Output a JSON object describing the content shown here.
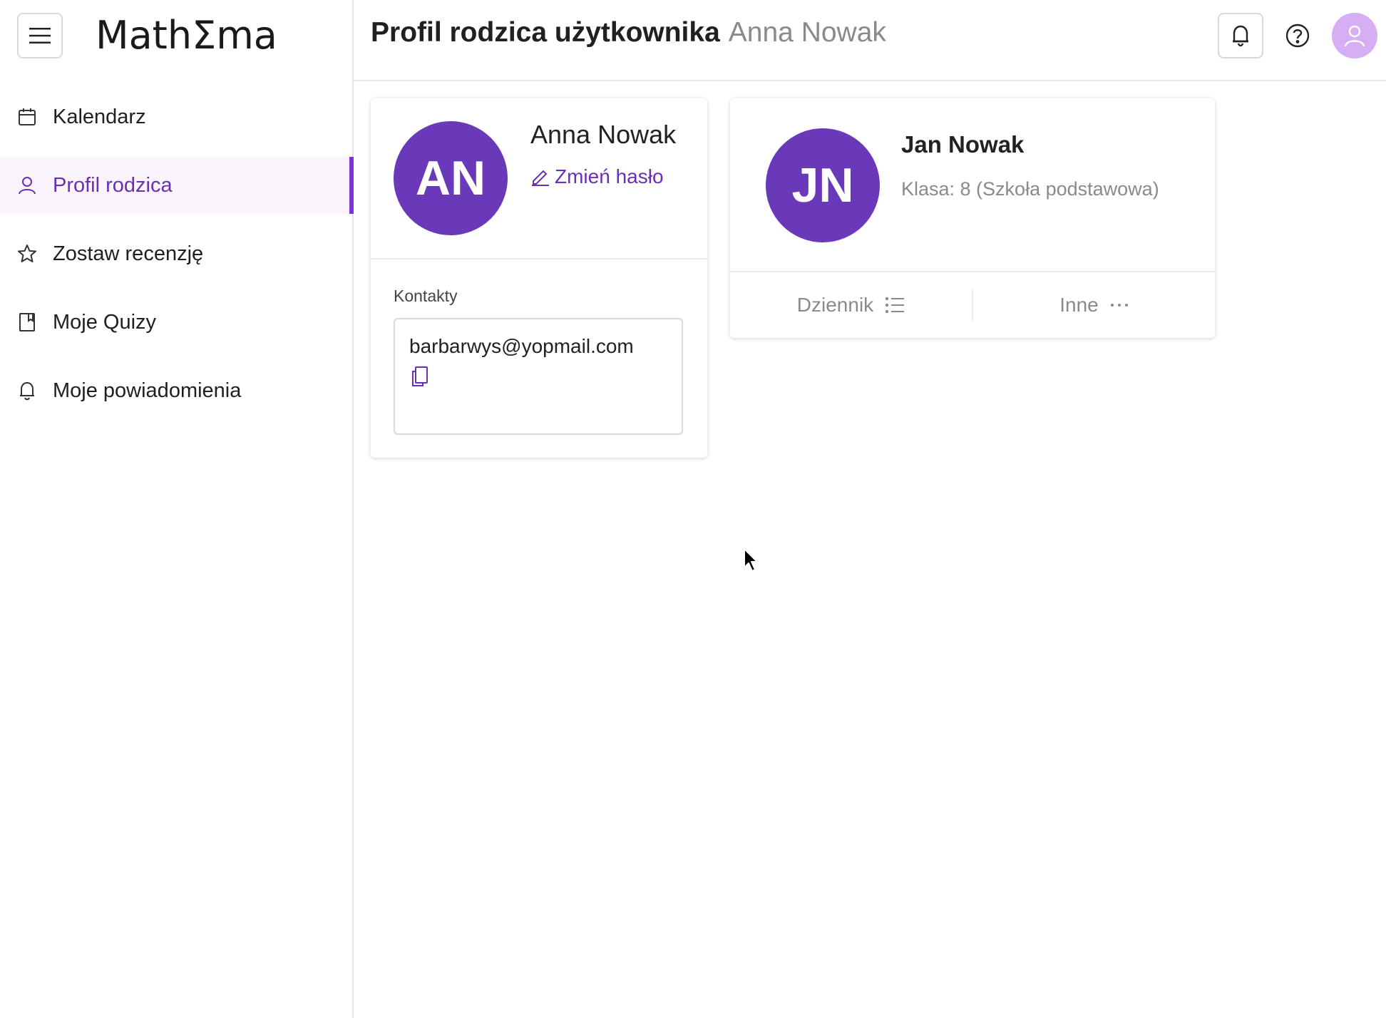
{
  "app": {
    "logo_text": "MathΣma"
  },
  "sidebar": {
    "items": [
      {
        "label": "Kalendarz",
        "icon": "calendar-icon",
        "active": false
      },
      {
        "label": "Profil rodzica",
        "icon": "user-icon",
        "active": true
      },
      {
        "label": "Zostaw recenzję",
        "icon": "star-icon",
        "active": false
      },
      {
        "label": "Moje Quizy",
        "icon": "bookmark-icon",
        "active": false
      },
      {
        "label": "Moje powiadomienia",
        "icon": "bell-icon",
        "active": false
      }
    ]
  },
  "header": {
    "title": "Profil rodzica użytkownika",
    "subtitle": "Anna Nowak"
  },
  "parent_card": {
    "initials": "AN",
    "name": "Anna Nowak",
    "change_password_label": "Zmień hasło",
    "contacts_label": "Kontakty",
    "email": "barbarwys@yopmail.com"
  },
  "child_card": {
    "initials": "JN",
    "name": "Jan Nowak",
    "class_label": "Klasa: 8 (Szkoła podstawowa)",
    "actions": [
      {
        "label": "Dziennik",
        "icon": "list-icon"
      },
      {
        "label": "Inne",
        "icon": "more-horizontal-icon"
      }
    ]
  },
  "colors": {
    "accent": "#6a2fb5",
    "avatar_bg": "#6a39b9",
    "active_bg": "#faf4fd",
    "user_avatar_bg": "#d6aef4"
  }
}
